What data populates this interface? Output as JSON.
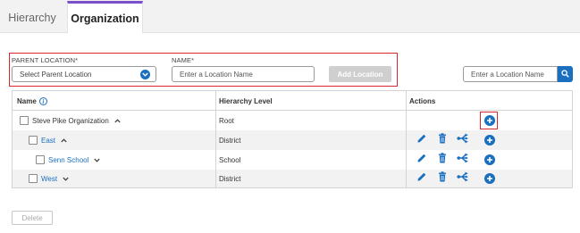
{
  "tabs": [
    {
      "label": "Hierarchy",
      "active": false
    },
    {
      "label": "Organization",
      "active": true
    }
  ],
  "form": {
    "parent_label": "PARENT LOCATION*",
    "parent_select_value": "Select Parent Location",
    "name_label": "NAME*",
    "name_placeholder": "Enter a Location Name",
    "add_button_label": "Add Location"
  },
  "search": {
    "placeholder": "Enter a Location Name"
  },
  "table": {
    "headers": {
      "name": "Name",
      "level": "Hierarchy Level",
      "actions": "Actions"
    },
    "rows": [
      {
        "name": "Steve Pike Organization",
        "level": "Root",
        "indent": 0,
        "link": false,
        "expanded": true
      },
      {
        "name": "East",
        "level": "District",
        "indent": 1,
        "link": true,
        "expanded": true
      },
      {
        "name": "Senn School",
        "level": "School",
        "indent": 2,
        "link": true,
        "expanded": false
      },
      {
        "name": "West",
        "level": "District",
        "indent": 1,
        "link": true,
        "expanded": false
      }
    ]
  },
  "footer": {
    "delete_label": "Delete"
  },
  "colors": {
    "accent_blue": "#1a6fbf",
    "highlight_red": "#d9262c",
    "tab_accent_purple": "#7b4fc9"
  }
}
